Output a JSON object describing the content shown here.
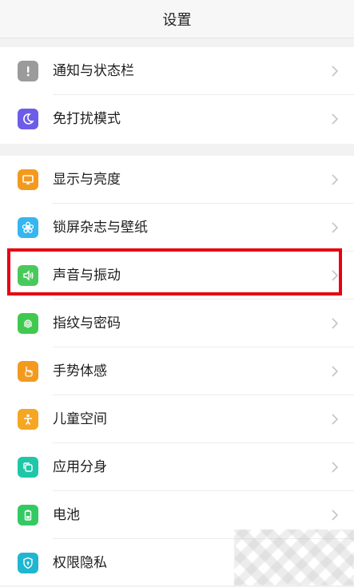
{
  "header": {
    "title": "设置"
  },
  "groups": [
    {
      "items": [
        {
          "label": "通知与状态栏",
          "icon": "exclamation-icon",
          "color": "#9b9b9b"
        },
        {
          "label": "免打扰模式",
          "icon": "moon-icon",
          "color": "#6c5ce7"
        }
      ]
    },
    {
      "items": [
        {
          "label": "显示与亮度",
          "icon": "monitor-icon",
          "color": "#f39a1e"
        },
        {
          "label": "锁屏杂志与壁纸",
          "icon": "flower-icon",
          "color": "#35b6f0"
        },
        {
          "label": "声音与振动",
          "icon": "speaker-icon",
          "color": "#49c95c"
        },
        {
          "label": "指纹与密码",
          "icon": "fingerprint-icon",
          "color": "#41c94f"
        },
        {
          "label": "手势体感",
          "icon": "hand-icon",
          "color": "#f39a1e"
        },
        {
          "label": "儿童空间",
          "icon": "child-icon",
          "color": "#f5a623"
        },
        {
          "label": "应用分身",
          "icon": "clone-icon",
          "color": "#1fc7a8"
        },
        {
          "label": "电池",
          "icon": "battery-icon",
          "color": "#35c964"
        },
        {
          "label": "权限隐私",
          "icon": "shield-icon",
          "color": "#1fb6d0"
        }
      ]
    }
  ],
  "highlight_color": "#e60012"
}
